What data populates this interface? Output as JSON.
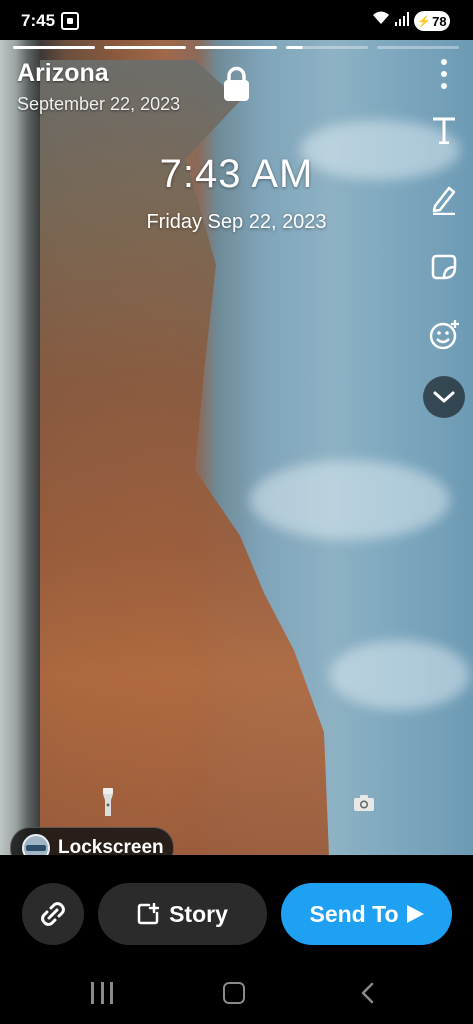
{
  "status_bar": {
    "time": "7:45",
    "battery": "78"
  },
  "story": {
    "title": "Arizona",
    "date": "September 22, 2023",
    "segments": [
      "done",
      "done",
      "done",
      "partial",
      "empty",
      "empty"
    ]
  },
  "overlay": {
    "clock": "7:43 AM",
    "clock_date": "Friday Sep 22, 2023"
  },
  "toolbar": {
    "items": [
      "more-options-icon",
      "text-tool-icon",
      "pencil-draw-icon",
      "sticker-icon",
      "emoji-lens-icon",
      "chevron-down-icon"
    ]
  },
  "chip": {
    "label": "Lockscreen"
  },
  "actions": {
    "story_label": "Story",
    "send_label": "Send To"
  },
  "colors": {
    "send_button": "#1ea1f2",
    "button_bg": "#2b2b2b"
  }
}
